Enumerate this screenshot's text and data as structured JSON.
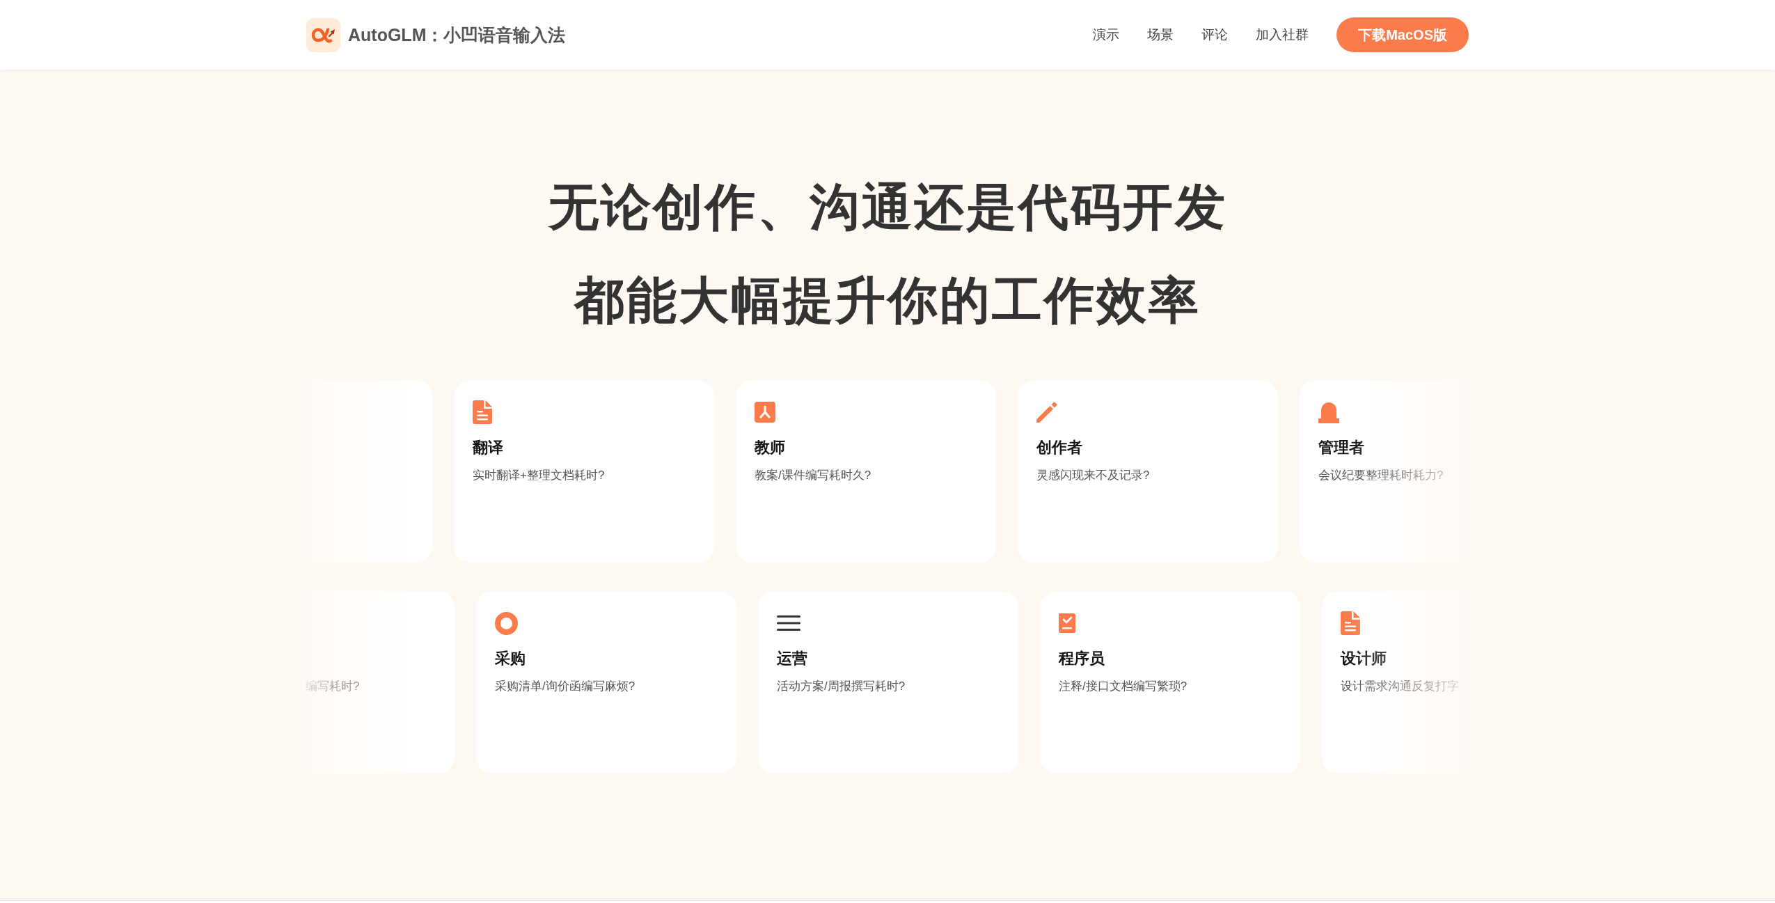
{
  "header": {
    "brand": {
      "title": "AutoGLM：小凹语音输入法"
    },
    "nav_links": [
      "演示",
      "场景",
      "评论",
      "加入社群"
    ],
    "download_button": "下载MacOS版"
  },
  "hero": {
    "title_lines": [
      "无论创作、沟通还是代码开发",
      "都能大幅提升你的工作效率"
    ]
  },
  "card_rows": [
    {
      "cards": [
        {
          "kind": "cut-left"
        },
        {
          "kind": "full",
          "title": "翻译",
          "description": "实时翻译+整理文档耗时?"
        },
        {
          "kind": "full",
          "title": "教师",
          "description": "教案/课件编写耗时久?"
        },
        {
          "kind": "full",
          "title": "创作者",
          "description": "灵感闪现来不及记录?"
        },
        {
          "kind": "cut-right",
          "title": "管理者",
          "description": "会议纪要整理耗时耗力?"
        }
      ]
    },
    {
      "cards": [
        {
          "kind": "cut-left",
          "description": "编写耗时?"
        },
        {
          "kind": "full",
          "title": "采购",
          "description": "采购清单/询价函编写麻烦?"
        },
        {
          "kind": "full",
          "title": "运营",
          "description": "活动方案/周报撰写耗时?"
        },
        {
          "kind": "full",
          "title": "程序员",
          "description": "注释/接口文档编写繁琐?"
        },
        {
          "kind": "cut-right",
          "title": "设计师",
          "description": "设计需求沟通反复打字"
        }
      ]
    }
  ]
}
